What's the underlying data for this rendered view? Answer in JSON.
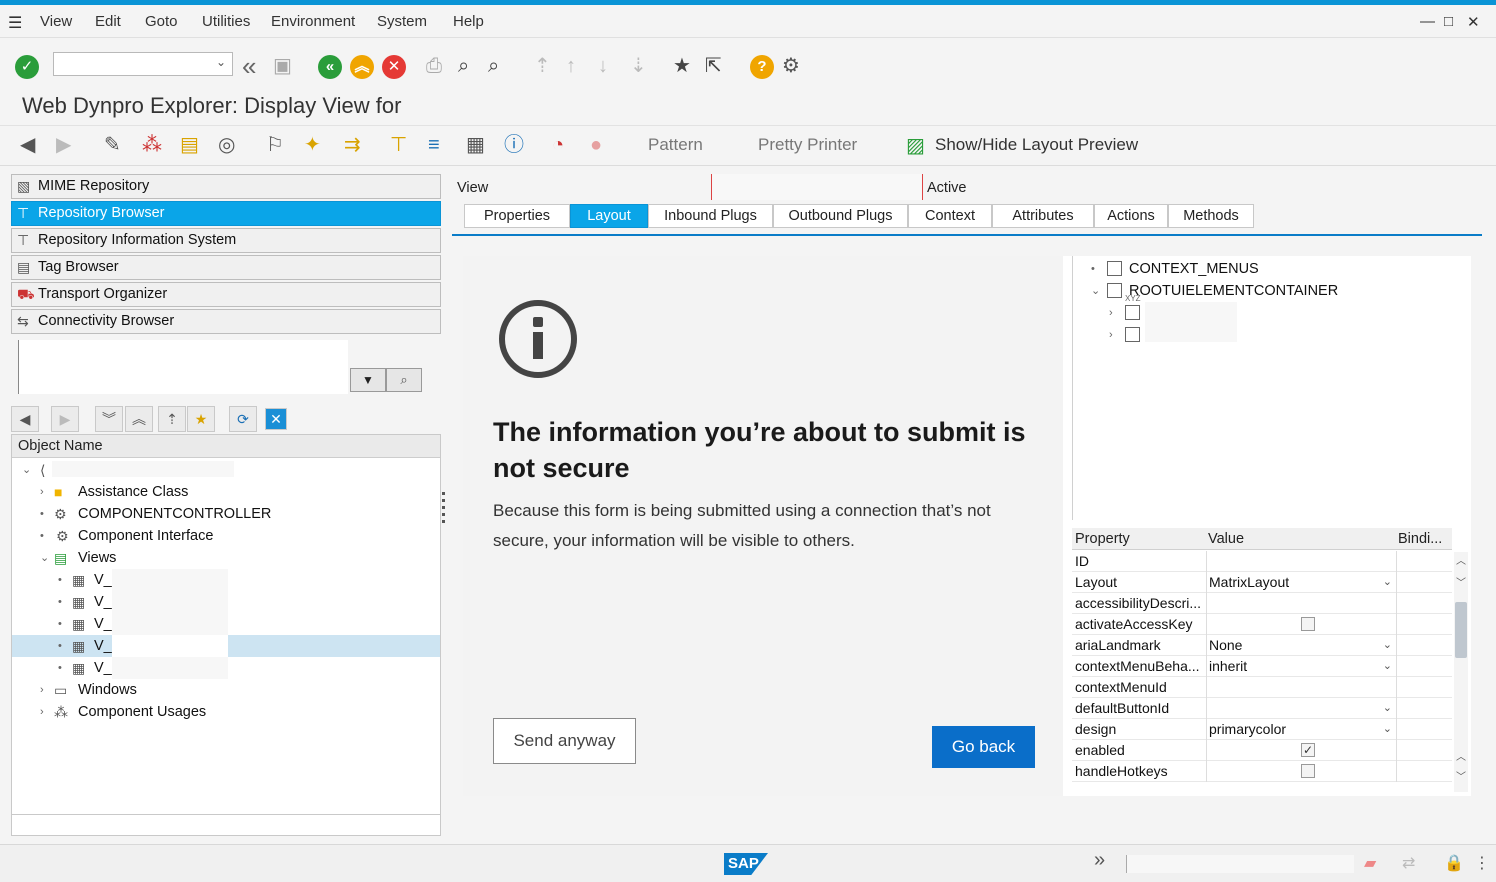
{
  "menu": {
    "items": [
      "View",
      "Edit",
      "Goto",
      "Utilities",
      "Environment",
      "System",
      "Help"
    ]
  },
  "window_controls": {
    "minimize": "—",
    "maximize": "□",
    "close": "✕"
  },
  "toolbar1": {
    "command_field_value": ""
  },
  "title": "Web Dynpro Explorer: Display View for",
  "toolbar2": {
    "pattern_label": "Pattern",
    "pretty_printer_label": "Pretty Printer",
    "layout_preview_label": "Show/Hide Layout Preview"
  },
  "navigation": {
    "items": [
      {
        "label": "MIME Repository",
        "icon": "mime-icon",
        "active": false
      },
      {
        "label": "Repository Browser",
        "icon": "repository-icon",
        "active": true
      },
      {
        "label": "Repository Information System",
        "icon": "info-system-icon",
        "active": false
      },
      {
        "label": "Tag Browser",
        "icon": "tag-icon",
        "active": false
      },
      {
        "label": "Transport Organizer",
        "icon": "truck-icon",
        "active": false
      },
      {
        "label": "Connectivity Browser",
        "icon": "connectivity-icon",
        "active": false
      }
    ]
  },
  "object_tree": {
    "header": "Object Name",
    "nodes": [
      {
        "label": "Assistance Class",
        "icon": "folder-icon",
        "level": 1,
        "expander": "›"
      },
      {
        "label": "COMPONENTCONTROLLER",
        "icon": "controller-icon",
        "level": 1,
        "expander": "•"
      },
      {
        "label": "Component Interface",
        "icon": "interface-icon",
        "level": 1,
        "expander": "•"
      },
      {
        "label": "Views",
        "icon": "views-icon",
        "level": 1,
        "expander": "⌄"
      },
      {
        "label": "V_",
        "icon": "view-icon",
        "level": 2,
        "expander": "•"
      },
      {
        "label": "V_",
        "icon": "view-icon",
        "level": 2,
        "expander": "•"
      },
      {
        "label": "V_",
        "icon": "view-icon",
        "level": 2,
        "expander": "•"
      },
      {
        "label": "V_",
        "icon": "view-icon",
        "level": 2,
        "expander": "•",
        "selected": true
      },
      {
        "label": "V_",
        "icon": "view-icon",
        "level": 2,
        "expander": "•"
      },
      {
        "label": "Windows",
        "icon": "windows-icon",
        "level": 1,
        "expander": "›"
      },
      {
        "label": "Component Usages",
        "icon": "usages-icon",
        "level": 1,
        "expander": "›"
      }
    ]
  },
  "view_header": {
    "label": "View",
    "status": "Active"
  },
  "tabs": [
    "Properties",
    "Layout",
    "Inbound Plugs",
    "Outbound Plugs",
    "Context",
    "Attributes",
    "Actions",
    "Methods"
  ],
  "active_tab": "Layout",
  "warning": {
    "title": "The information you’re about to submit is not secure",
    "body": "Because this form is being submitted using a connection that’s not secure, your information will be visible to others.",
    "send_anyway": "Send anyway",
    "go_back": "Go back"
  },
  "ui_tree": {
    "nodes": [
      {
        "label": "CONTEXT_MENUS",
        "expander": "•"
      },
      {
        "label": "ROOTUIELEMENTCONTAINER",
        "expander": "⌄"
      },
      {
        "label": "",
        "expander": "›",
        "badge": "XYZ"
      },
      {
        "label": "",
        "expander": "›",
        "badge": ""
      }
    ]
  },
  "properties": {
    "headers": {
      "property": "Property",
      "value": "Value",
      "binding": "Bindi..."
    },
    "rows": [
      {
        "name": "ID",
        "value": "",
        "type": "text"
      },
      {
        "name": "Layout",
        "value": "MatrixLayout",
        "type": "select"
      },
      {
        "name": "accessibilityDescri...",
        "value": "",
        "type": "text"
      },
      {
        "name": "activateAccessKey",
        "value": "",
        "type": "checkbox",
        "checked": false
      },
      {
        "name": "ariaLandmark",
        "value": "None",
        "type": "select"
      },
      {
        "name": "contextMenuBeha...",
        "value": "inherit",
        "type": "select"
      },
      {
        "name": "contextMenuId",
        "value": "",
        "type": "text"
      },
      {
        "name": "defaultButtonId",
        "value": "",
        "type": "select"
      },
      {
        "name": "design",
        "value": "primarycolor",
        "type": "select"
      },
      {
        "name": "enabled",
        "value": "",
        "type": "checkbox",
        "checked": true
      },
      {
        "name": "handleHotkeys",
        "value": "",
        "type": "checkbox",
        "checked": false
      }
    ]
  },
  "statusbar": {
    "logo": "SAP"
  },
  "colors": {
    "accent": "#0a94d6",
    "active_nav": "#0aa5e8",
    "go_back": "#0a6ec9",
    "confirm_green": "#2a9d3a",
    "back_green": "#2a9d3a",
    "exit_orange": "#f0a500",
    "cancel_red": "#e53935",
    "help_yellow": "#f0a500"
  }
}
